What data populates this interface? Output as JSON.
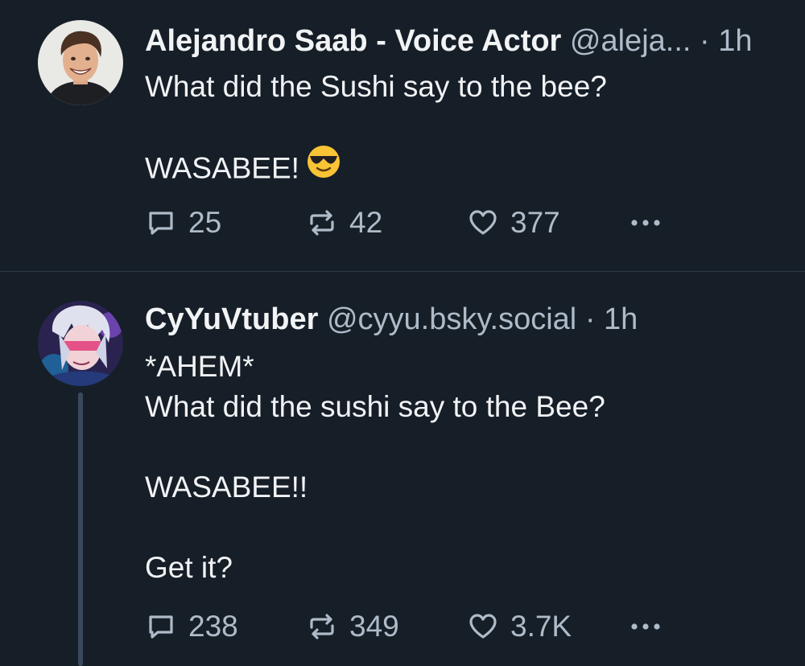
{
  "posts": [
    {
      "display_name": "Alejandro Saab - Voice Actor",
      "handle": "@aleja...",
      "separator": "·",
      "time": "1h",
      "lines": [
        "What did the Sushi say to the bee?",
        "",
        "WASABEE!"
      ],
      "emoji": "smiling-face-with-sunglasses",
      "avatar": "profile-photo",
      "stats": {
        "replies": "25",
        "reposts": "42",
        "likes": "377"
      }
    },
    {
      "display_name": "CyYuVtuber",
      "handle": "@cyyu.bsky.social",
      "separator": "·",
      "time": "1h",
      "lines": [
        "*AHEM*",
        "What did the sushi say to the Bee?",
        "",
        "WASABEE!!",
        "",
        "Get it?"
      ],
      "avatar": "anime-character-avatar",
      "stats": {
        "replies": "238",
        "reposts": "349",
        "likes": "3.7K"
      }
    }
  ],
  "icons": {
    "reply": "speech-bubble-icon",
    "repost": "repost-arrows-icon",
    "like": "heart-icon",
    "more": "more-dots-icon"
  },
  "colors": {
    "background": "#161e27",
    "primary_text": "#f1f3f5",
    "secondary_text": "#aebbc9",
    "divider": "#2e3a47",
    "thread_line": "#3a4a5c"
  }
}
